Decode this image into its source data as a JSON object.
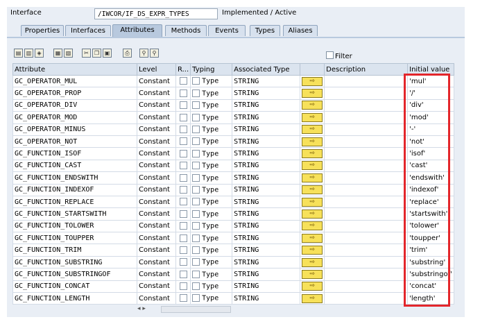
{
  "header": {
    "label": "Interface",
    "name": "/IWCOR/IF_DS_EXPR_TYPES",
    "status": "Implemented / Active"
  },
  "tabs": [
    "Properties",
    "Interfaces",
    "Attributes",
    "Methods",
    "Events",
    "Types",
    "Aliases"
  ],
  "active_tab": "Attributes",
  "filter_label": "Filter",
  "columns": {
    "attribute": "Attribute",
    "level": "Level",
    "r": "R...",
    "typing": "Typing",
    "assoc": "Associated Type",
    "description": "Description",
    "initial": "Initial value"
  },
  "rows": [
    {
      "attr": "GC_OPERATOR_MUL",
      "level": "Constant",
      "typing": "Type",
      "assoc": "STRING",
      "initial": "'mul'"
    },
    {
      "attr": "GC_OPERATOR_PROP",
      "level": "Constant",
      "typing": "Type",
      "assoc": "STRING",
      "initial": "'/'"
    },
    {
      "attr": "GC_OPERATOR_DIV",
      "level": "Constant",
      "typing": "Type",
      "assoc": "STRING",
      "initial": "'div'"
    },
    {
      "attr": "GC_OPERATOR_MOD",
      "level": "Constant",
      "typing": "Type",
      "assoc": "STRING",
      "initial": "'mod'"
    },
    {
      "attr": "GC_OPERATOR_MINUS",
      "level": "Constant",
      "typing": "Type",
      "assoc": "STRING",
      "initial": "'-'"
    },
    {
      "attr": "GC_OPERATOR_NOT",
      "level": "Constant",
      "typing": "Type",
      "assoc": "STRING",
      "initial": "'not'"
    },
    {
      "attr": "GC_FUNCTION_ISOF",
      "level": "Constant",
      "typing": "Type",
      "assoc": "STRING",
      "initial": "'isof'"
    },
    {
      "attr": "GC_FUNCTION_CAST",
      "level": "Constant",
      "typing": "Type",
      "assoc": "STRING",
      "initial": "'cast'"
    },
    {
      "attr": "GC_FUNCTION_ENDSWITH",
      "level": "Constant",
      "typing": "Type",
      "assoc": "STRING",
      "initial": "'endswith'"
    },
    {
      "attr": "GC_FUNCTION_INDEXOF",
      "level": "Constant",
      "typing": "Type",
      "assoc": "STRING",
      "initial": "'indexof'"
    },
    {
      "attr": "GC_FUNCTION_REPLACE",
      "level": "Constant",
      "typing": "Type",
      "assoc": "STRING",
      "initial": "'replace'"
    },
    {
      "attr": "GC_FUNCTION_STARTSWITH",
      "level": "Constant",
      "typing": "Type",
      "assoc": "STRING",
      "initial": "'startswith'"
    },
    {
      "attr": "GC_FUNCTION_TOLOWER",
      "level": "Constant",
      "typing": "Type",
      "assoc": "STRING",
      "initial": "'tolower'"
    },
    {
      "attr": "GC_FUNCTION_TOUPPER",
      "level": "Constant",
      "typing": "Type",
      "assoc": "STRING",
      "initial": "'toupper'"
    },
    {
      "attr": "GC_FUNCTION_TRIM",
      "level": "Constant",
      "typing": "Type",
      "assoc": "STRING",
      "initial": "'trim'"
    },
    {
      "attr": "GC_FUNCTION_SUBSTRING",
      "level": "Constant",
      "typing": "Type",
      "assoc": "STRING",
      "initial": "'substring'"
    },
    {
      "attr": "GC_FUNCTION_SUBSTRINGOF",
      "level": "Constant",
      "typing": "Type",
      "assoc": "STRING",
      "initial": "'substringof'"
    },
    {
      "attr": "GC_FUNCTION_CONCAT",
      "level": "Constant",
      "typing": "Type",
      "assoc": "STRING",
      "initial": "'concat'"
    },
    {
      "attr": "GC_FUNCTION_LENGTH",
      "level": "Constant",
      "typing": "Type",
      "assoc": "STRING",
      "initial": "'length'"
    }
  ],
  "toolbar_icons": [
    "select-all-icon",
    "deselect-icon",
    "details-icon",
    "insert-row-icon",
    "delete-row-icon",
    "cut-icon",
    "copy-icon",
    "paste-icon",
    "print-icon",
    "find-icon",
    "find-next-icon"
  ],
  "colors": {
    "highlight_box": "#e3262b",
    "navigate_button": "#f7e15a",
    "active_tab": "#b8c9de"
  }
}
